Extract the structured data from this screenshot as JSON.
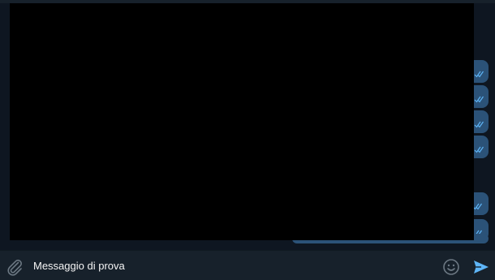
{
  "composer": {
    "message_text": "Messaggio di prova",
    "attach_icon": "paperclip-icon",
    "emoji_icon": "smiley-icon",
    "send_icon": "send-arrow-icon"
  },
  "overlay": {
    "color": "#000000",
    "description_visible": false
  },
  "colors": {
    "background": "#0e1621",
    "composer_background": "#17212b",
    "outgoing_bubble": "#2b5278",
    "accent": "#5eb5f7",
    "icon_gray": "#6c7883"
  },
  "messages": {
    "outgoing_count_visible": 7,
    "status": "read-double-check"
  }
}
